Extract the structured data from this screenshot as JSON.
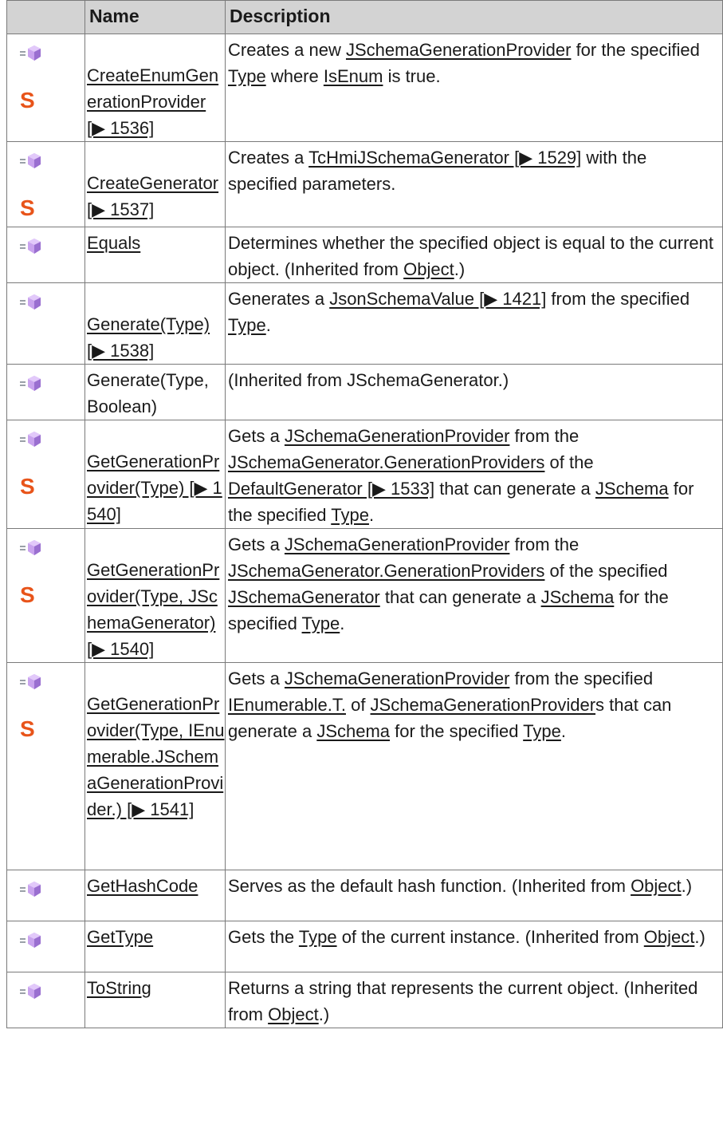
{
  "table": {
    "headers": [
      "",
      "Name",
      "Description"
    ],
    "rows": [
      {
        "static": true,
        "name": [
          {
            "t": "CreateEnumGenerationProvider [▶ 1536]",
            "link": true
          }
        ],
        "desc": [
          {
            "t": "Creates a new ",
            "link": false
          },
          {
            "t": "JSchemaGenerationProvider",
            "link": true
          },
          {
            "t": " for the specified ",
            "link": false
          },
          {
            "t": "Type",
            "link": true
          },
          {
            "t": " where ",
            "link": false
          },
          {
            "t": "IsEnum",
            "link": true
          },
          {
            "t": " is true.",
            "link": false
          }
        ]
      },
      {
        "static": true,
        "name": [
          {
            "t": "CreateGenerator [▶ 1537]",
            "link": true
          }
        ],
        "desc": [
          {
            "t": "Creates a ",
            "link": false
          },
          {
            "t": "TcHmiJSchemaGenerator [▶ 1529]",
            "link": true
          },
          {
            "t": " with the specified parameters.",
            "link": false
          }
        ]
      },
      {
        "static": false,
        "name": [
          {
            "t": "Equals",
            "link": true
          }
        ],
        "desc": [
          {
            "t": "Determines whether the specified object is equal to the current object. (Inherited from ",
            "link": false
          },
          {
            "t": "Object",
            "link": true
          },
          {
            "t": ".)",
            "link": false
          }
        ]
      },
      {
        "static": false,
        "name": [
          {
            "t": "Generate(Type) [▶ 1538]",
            "link": true
          }
        ],
        "desc": [
          {
            "t": "Generates a ",
            "link": false
          },
          {
            "t": "JsonSchemaValue [▶ 1421]",
            "link": true
          },
          {
            "t": " from the specified ",
            "link": false
          },
          {
            "t": "Type",
            "link": true
          },
          {
            "t": ".",
            "link": false
          }
        ]
      },
      {
        "static": false,
        "name": [
          {
            "t": "Generate(Type, Boolean)",
            "link": false
          }
        ],
        "desc": [
          {
            "t": "(Inherited from JSchemaGenerator.)",
            "link": false
          }
        ]
      },
      {
        "static": true,
        "name": [
          {
            "t": "GetGenerationProvider(Type) [▶ 1540]",
            "link": true
          }
        ],
        "desc": [
          {
            "t": "Gets a ",
            "link": false
          },
          {
            "t": "JSchemaGenerationProvider",
            "link": true
          },
          {
            "t": " from the ",
            "link": false
          },
          {
            "t": "JSchemaGenerator.GenerationProviders",
            "link": true
          },
          {
            "t": " of the ",
            "link": false
          },
          {
            "t": "DefaultGenerator [▶ 1533]",
            "link": true
          },
          {
            "t": " that can generate a ",
            "link": false
          },
          {
            "t": "JSchema",
            "link": true
          },
          {
            "t": " for the specified ",
            "link": false
          },
          {
            "t": "Type",
            "link": true
          },
          {
            "t": ".",
            "link": false
          }
        ]
      },
      {
        "static": true,
        "name": [
          {
            "t": "GetGenerationProvider(Type, JSchemaGenerator) [▶ 1540]",
            "link": true
          }
        ],
        "desc": [
          {
            "t": "Gets a ",
            "link": false
          },
          {
            "t": "JSchemaGenerationProvider",
            "link": true
          },
          {
            "t": " from the ",
            "link": false
          },
          {
            "t": "JSchemaGenerator.GenerationProviders",
            "link": true
          },
          {
            "t": " of the specified ",
            "link": false
          },
          {
            "t": "JSchemaGenerator",
            "link": true
          },
          {
            "t": " that can generate a ",
            "link": false
          },
          {
            "t": "JSchema",
            "link": true
          },
          {
            "t": " for the specified ",
            "link": false
          },
          {
            "t": "Type",
            "link": true
          },
          {
            "t": ".",
            "link": false
          }
        ]
      },
      {
        "static": true,
        "name": [
          {
            "t": "GetGenerationProvider(Type, IEnumerable.JSchemaGenerationProvider.) [▶ 1541]",
            "link": true
          }
        ],
        "desc": [
          {
            "t": "Gets a ",
            "link": false
          },
          {
            "t": "JSchemaGenerationProvider",
            "link": true
          },
          {
            "t": " from the specified ",
            "link": false
          },
          {
            "t": "IEnumerable.T.",
            "link": true
          },
          {
            "t": " of ",
            "link": false
          },
          {
            "t": "JSchemaGenerationProvider",
            "link": true
          },
          {
            "t": "s that can generate a ",
            "link": false
          },
          {
            "t": "JSchema",
            "link": true
          },
          {
            "t": " for the specified ",
            "link": false
          },
          {
            "t": "Type",
            "link": true
          },
          {
            "t": ".",
            "link": false
          }
        ]
      },
      {
        "static": false,
        "name": [
          {
            "t": "GetHashCode",
            "link": true
          }
        ],
        "desc": [
          {
            "t": "Serves as the default hash function. (Inherited from ",
            "link": false
          },
          {
            "t": "Object",
            "link": true
          },
          {
            "t": ".)",
            "link": false
          }
        ]
      },
      {
        "static": false,
        "name": [
          {
            "t": "GetType",
            "link": true
          }
        ],
        "desc": [
          {
            "t": "Gets the ",
            "link": false
          },
          {
            "t": "Type",
            "link": true
          },
          {
            "t": " of the current instance. (Inherited from ",
            "link": false
          },
          {
            "t": "Object",
            "link": true
          },
          {
            "t": ".)",
            "link": false
          }
        ]
      },
      {
        "static": false,
        "name": [
          {
            "t": "ToString",
            "link": true
          }
        ],
        "desc": [
          {
            "t": "Returns a string that represents the current object. (Inherited from ",
            "link": false
          },
          {
            "t": "Object",
            "link": true
          },
          {
            "t": ".)",
            "link": false
          }
        ]
      }
    ]
  },
  "icons": {
    "method": "public-method-icon",
    "static": "static-member-icon",
    "method_color": "#b78fe0",
    "static_color": "#e8541a"
  }
}
